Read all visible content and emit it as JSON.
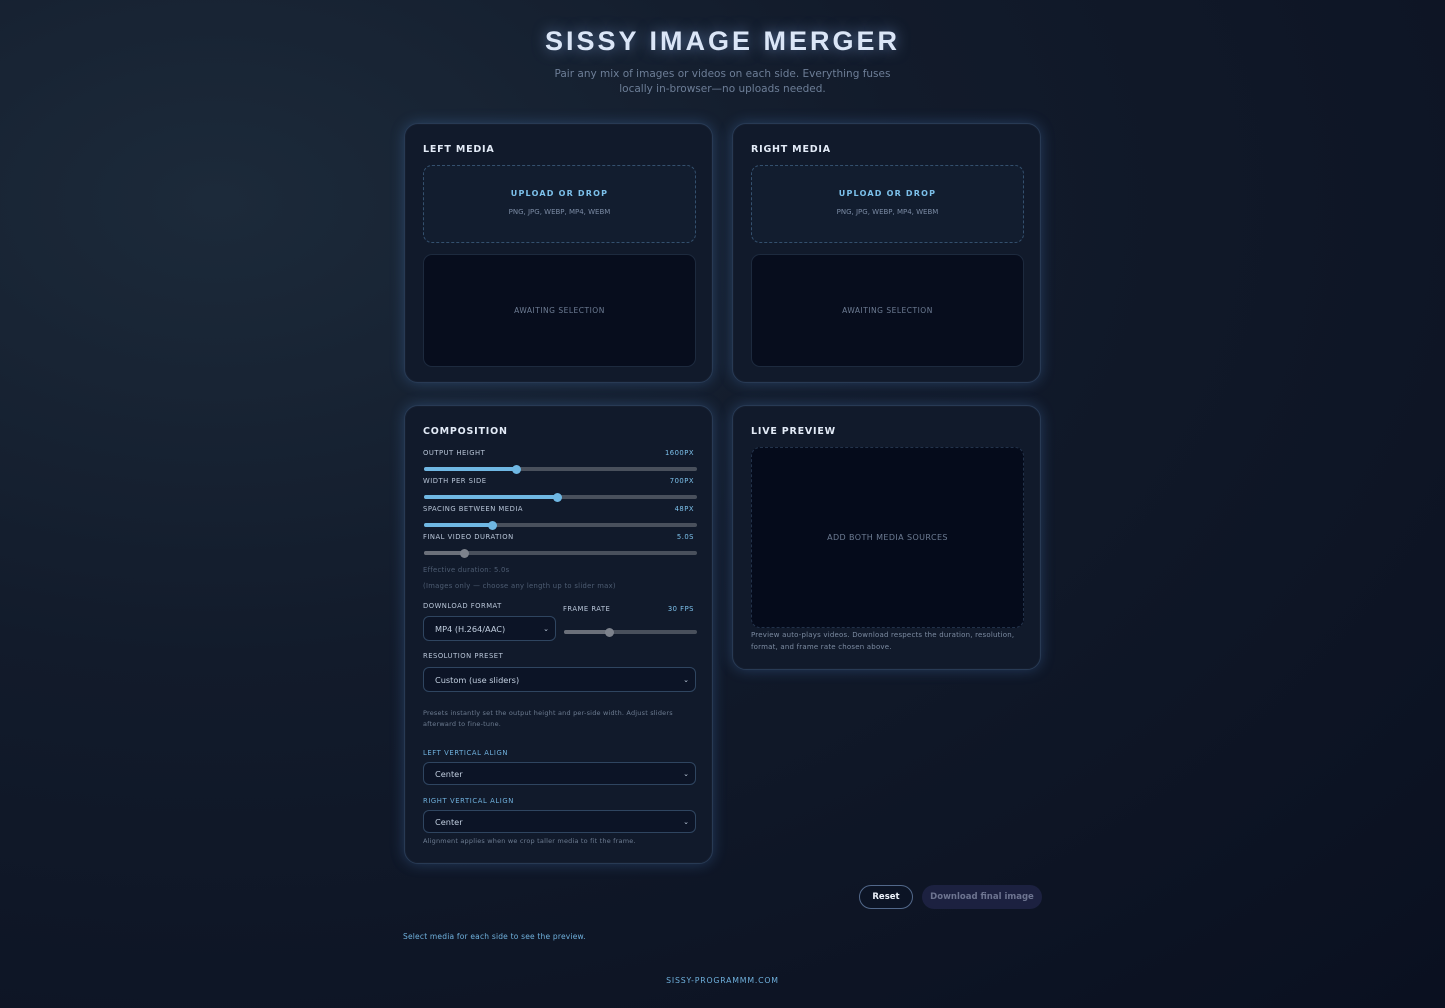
{
  "header": {
    "title": "SISSY IMAGE MERGER",
    "subtitle": "Pair any mix of images or videos on each side. Everything fuses locally in-browser—no uploads needed."
  },
  "left_media": {
    "title": "LEFT MEDIA",
    "upload_label": "UPLOAD OR DROP",
    "upload_formats": "PNG, JPG, WEBP, MP4, WEBM",
    "placeholder": "AWAITING SELECTION"
  },
  "right_media": {
    "title": "RIGHT MEDIA",
    "upload_label": "UPLOAD OR DROP",
    "upload_formats": "PNG, JPG, WEBP, MP4, WEBM",
    "placeholder": "AWAITING SELECTION"
  },
  "composition": {
    "title": "COMPOSITION",
    "sliders": [
      {
        "label": "OUTPUT HEIGHT",
        "value_text": "1600PX",
        "fraction": 0.34
      },
      {
        "label": "WIDTH PER SIDE",
        "value_text": "700PX",
        "fraction": 0.49
      },
      {
        "label": "SPACING BETWEEN MEDIA",
        "value_text": "48PX",
        "fraction": 0.25
      },
      {
        "label": "FINAL VIDEO DURATION",
        "value_text": "5.0S",
        "fraction": 0.15
      }
    ],
    "effective_duration": "Effective duration: 5.0s",
    "images_note": "(Images only — choose any length up to slider max)",
    "download_format_label": "DOWNLOAD FORMAT",
    "download_format_value": "MP4 (H.264/AAC)",
    "frame_rate_label": "FRAME RATE",
    "frame_rate_value": "30 FPS",
    "frame_rate_fraction": 0.34,
    "resolution_label": "RESOLUTION PRESET",
    "resolution_value": "Custom (use sliders)",
    "resolution_help": "Presets instantly set the output height and per-side width. Adjust sliders afterward to fine-tune.",
    "left_align_label": "LEFT VERTICAL ALIGN",
    "left_align_value": "Center",
    "right_align_label": "RIGHT VERTICAL ALIGN",
    "right_align_value": "Center",
    "align_help": "Alignment applies when we crop taller media to fit the frame."
  },
  "live_preview": {
    "title": "LIVE PREVIEW",
    "placeholder": "ADD BOTH MEDIA SOURCES",
    "help": "Preview auto-plays videos. Download respects the duration, resolution, format, and frame rate chosen above."
  },
  "actions": {
    "reset_label": "Reset",
    "download_label": "Download final image"
  },
  "status_text": "Select media for each side to see the preview.",
  "footer": "SISSY-PROGRAMMM.COM",
  "icons": {
    "chevron": "chevron-down-icon"
  },
  "colors": {
    "accent": "#6fb7e3",
    "background": "#0a1020",
    "card": "#111a2b"
  }
}
